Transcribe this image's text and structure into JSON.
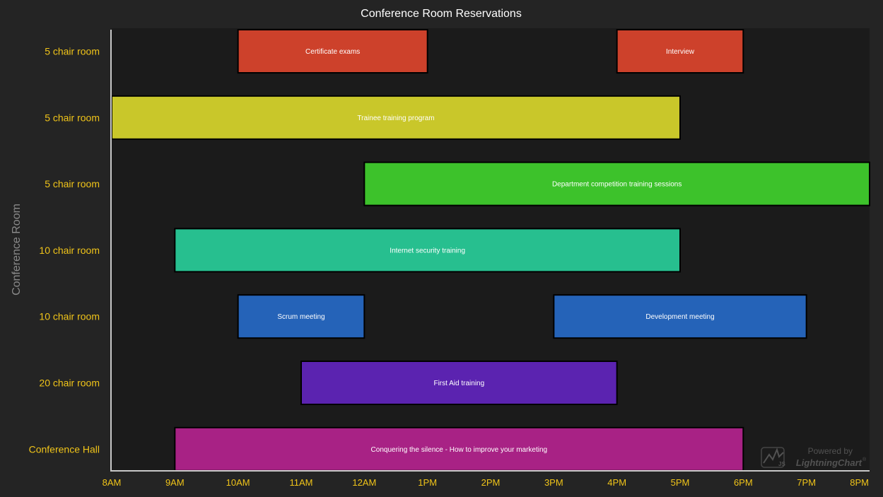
{
  "chart_data": {
    "type": "bar",
    "orientation": "horizontal-range",
    "title": "Conference Room Reservations",
    "xlabel": "",
    "ylabel": "Conference Room",
    "x_ticks": [
      "8AM",
      "9AM",
      "10AM",
      "11AM",
      "12AM",
      "1PM",
      "2PM",
      "3PM",
      "4PM",
      "5PM",
      "6PM",
      "7PM",
      "8PM"
    ],
    "xlim": [
      8,
      20
    ],
    "categories": [
      "5 chair room",
      "5 chair room",
      "5 chair room",
      "10 chair room",
      "10 chair room",
      "20 chair room",
      "Conference Hall"
    ],
    "series": [
      {
        "category_index": 0,
        "color": "#cd412b",
        "bars": [
          {
            "label": "Certificate exams",
            "start": 10,
            "end": 13
          },
          {
            "label": "Interview",
            "start": 16,
            "end": 18
          }
        ]
      },
      {
        "category_index": 1,
        "color": "#c9c72a",
        "bars": [
          {
            "label": "Trainee training program",
            "start": 8,
            "end": 17
          }
        ]
      },
      {
        "category_index": 2,
        "color": "#3dc22b",
        "bars": [
          {
            "label": "Department competition training sessions",
            "start": 12,
            "end": 20
          }
        ]
      },
      {
        "category_index": 3,
        "color": "#27bf8f",
        "bars": [
          {
            "label": "Internet security training",
            "start": 9,
            "end": 17
          }
        ]
      },
      {
        "category_index": 4,
        "color": "#2563b8",
        "bars": [
          {
            "label": "Scrum meeting",
            "start": 10,
            "end": 12
          },
          {
            "label": "Development meeting",
            "start": 15,
            "end": 19
          }
        ]
      },
      {
        "category_index": 5,
        "color": "#5b23b0",
        "bars": [
          {
            "label": "First Aid training",
            "start": 11,
            "end": 16
          }
        ]
      },
      {
        "category_index": 6,
        "color": "#a82285",
        "bars": [
          {
            "label": "Conquering the silence - How to improve your marketing",
            "start": 9,
            "end": 18
          }
        ]
      }
    ],
    "grid": false,
    "legend": "none"
  },
  "colors": {
    "background": "#242424",
    "plot_background": "#1b1b1b",
    "axis_line": "#c8c8c8",
    "label_color": "#f0c419",
    "title_color": "#ffffff",
    "axis_title_color": "#8a8a8a",
    "bar_border": "#000000"
  },
  "watermark": {
    "line1": "Powered by",
    "line2": "LightningChart",
    "mark": "®",
    "logo_text": "JS",
    "icon": "lightningchart-logo-icon"
  }
}
